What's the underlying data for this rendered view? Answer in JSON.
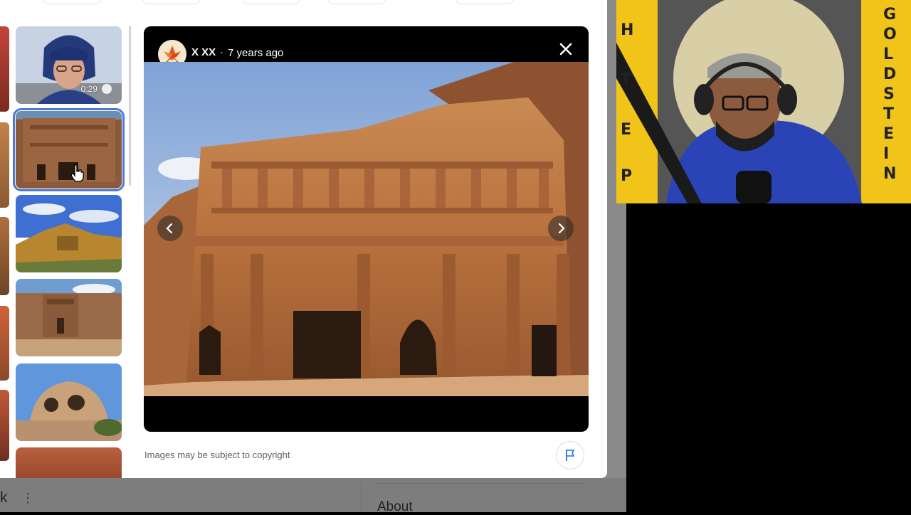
{
  "viewer": {
    "author": "X XX",
    "separator": "·",
    "age": "7 years ago",
    "close_label": "Close",
    "prev_label": "Previous image",
    "next_label": "Next image"
  },
  "thumbnails": [
    {
      "duration": "0:29",
      "selected": false
    },
    {
      "selected": true
    },
    {
      "selected": false
    },
    {
      "selected": false
    },
    {
      "selected": false
    },
    {
      "selected": false
    }
  ],
  "footer": {
    "copyright_notice": "Images may be subject to copyright",
    "report_label": "Report"
  },
  "background_page": {
    "fragment_text": "k",
    "kebab_glyph": "⋮",
    "about_heading": "About"
  },
  "webcam": {
    "banner_letters_left": [
      "H",
      "T",
      "E",
      "P"
    ],
    "banner_letters_right": [
      "G",
      "O",
      "L",
      "D",
      "S",
      "T",
      "E",
      "I",
      "N"
    ]
  },
  "colors": {
    "selection_outline": "#4c79d6",
    "viewer_bg": "#000000",
    "banner_yellow": "#f0c419",
    "shirt_blue": "#2a44b8"
  }
}
